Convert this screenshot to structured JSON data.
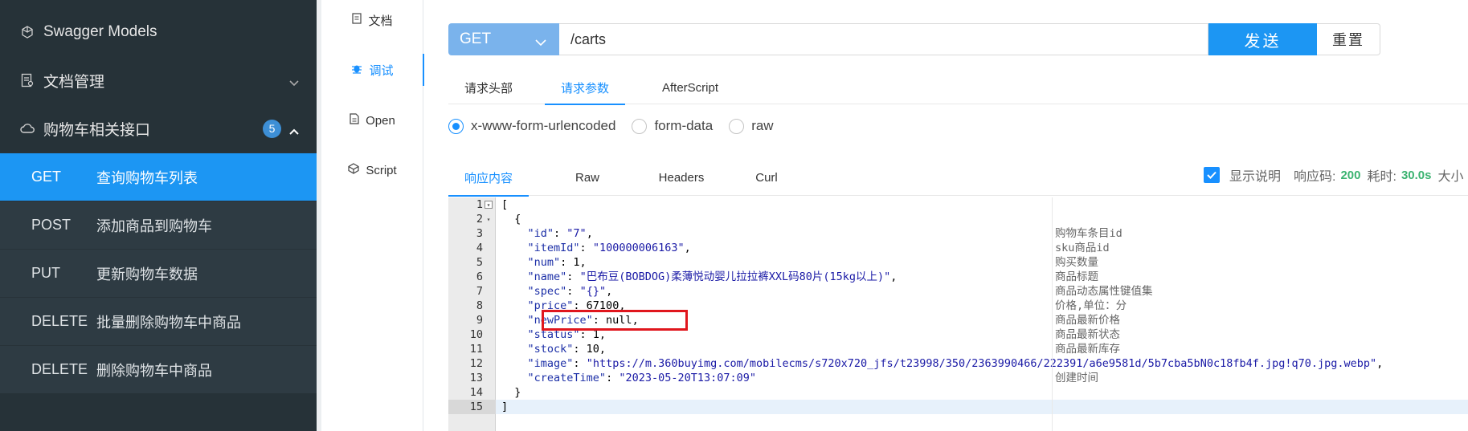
{
  "sidebar": {
    "header": "Swagger Models",
    "docs_mgmt": "文档管理",
    "group": "购物车相关接口",
    "group_badge": "5",
    "items": [
      {
        "method": "GET",
        "label": "查询购物车列表"
      },
      {
        "method": "POST",
        "label": "添加商品到购物车"
      },
      {
        "method": "PUT",
        "label": "更新购物车数据"
      },
      {
        "method": "DELETE",
        "label": "批量删除购物车中商品"
      },
      {
        "method": "DELETE",
        "label": "删除购物车中商品"
      }
    ]
  },
  "midnav": {
    "doc": "文档",
    "debug": "调试",
    "open": "Open",
    "script": "Script"
  },
  "request": {
    "method": "GET",
    "url": "/carts",
    "send": "发送",
    "reset": "重置"
  },
  "request_tabs": [
    "请求头部",
    "请求参数",
    "AfterScript"
  ],
  "body_types": [
    "x-www-form-urlencoded",
    "form-data",
    "raw"
  ],
  "response_tabs": [
    "响应内容",
    "Raw",
    "Headers",
    "Curl"
  ],
  "response_info": {
    "show_desc": "显示说明",
    "code_label": "响应码:",
    "code": "200",
    "time_label": "耗时:",
    "time": "30.0s",
    "size_label": "大小"
  },
  "code_lines": [
    "[",
    "  {",
    "    \"id\": \"7\",",
    "    \"itemId\": \"100000006163\",",
    "    \"num\": 1,",
    "    \"name\": \"巴布豆(BOBDOG)柔薄悦动婴儿拉拉裤XXL码80片(15kg以上)\",",
    "    \"spec\": \"{}\",",
    "    \"price\": 67100,",
    "    \"newPrice\": null,",
    "    \"status\": 1,",
    "    \"stock\": 10,",
    "    \"image\": \"https://m.360buyimg.com/mobilecms/s720x720_jfs/t23998/350/2363990466/222391/a6e9581d/5b7cba5bN0c18fb4f.jpg!q70.jpg.webp\",",
    "    \"createTime\": \"2023-05-20T13:07:09\"",
    "  }",
    "]"
  ],
  "line_numbers": [
    "1",
    "2",
    "3",
    "4",
    "5",
    "6",
    "7",
    "8",
    "9",
    "10",
    "11",
    "12",
    "13",
    "14",
    "15"
  ],
  "descriptions": {
    "3": "购物车条目id",
    "4": "sku商品id",
    "5": "购买数量",
    "6": "商品标题",
    "7": "商品动态属性键值集",
    "8": "价格,单位：分",
    "9": "商品最新价格",
    "10": "商品最新状态",
    "11": "商品最新库存",
    "13": "创建时间"
  },
  "colors": {
    "sidebar_bg": "#263238",
    "active_blue": "#1c96f3",
    "accent": "#1890ff",
    "highlight_red": "#e0161d",
    "status_green": "#3cb371"
  }
}
